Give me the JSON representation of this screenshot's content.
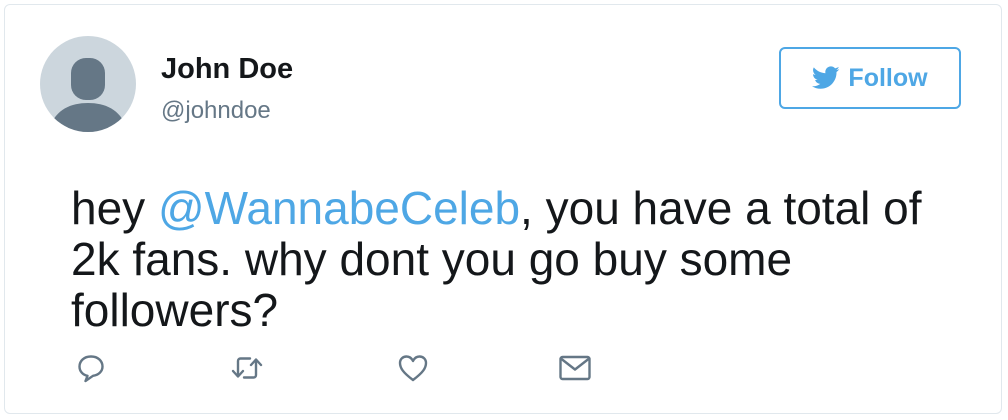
{
  "user": {
    "name": "John Doe",
    "handle": "@johndoe"
  },
  "follow_button": {
    "label": "Follow",
    "icon": "twitter-bird-icon"
  },
  "tweet": {
    "text_before": "hey ",
    "mention": "@WannabeCeleb",
    "text_after": ", you have a total of 2k fans. why dont you go buy some followers?"
  },
  "actions": [
    "reply-icon",
    "retweet-icon",
    "like-icon",
    "message-icon"
  ],
  "colors": {
    "accent": "#4ea7e5",
    "text": "#14171a",
    "secondary_text": "#657786",
    "icon": "#657786",
    "border": "#e1e8ed",
    "avatar_bg": "#ccd6dd",
    "avatar_silhouette": "#657786"
  }
}
